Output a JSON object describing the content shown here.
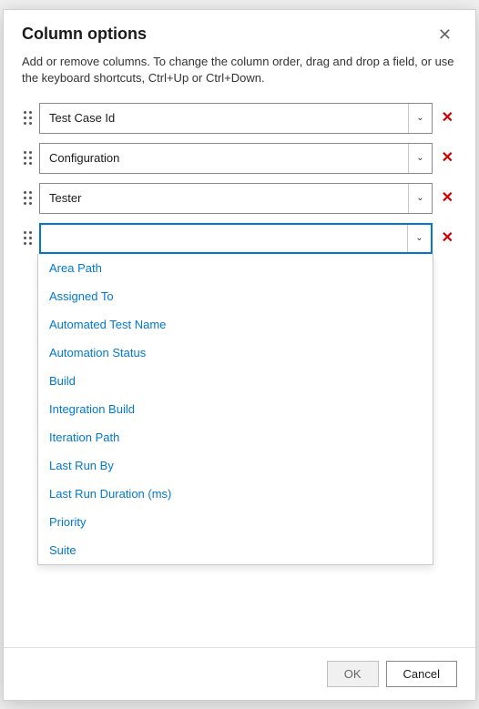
{
  "dialog": {
    "title": "Column options",
    "description": "Add or remove columns. To change the column order, drag and drop a field, or use the keyboard shortcuts, Ctrl+Up or Ctrl+Down.",
    "close_label": "✕"
  },
  "columns": [
    {
      "id": "test-case-id",
      "label": "Test Case Id"
    },
    {
      "id": "configuration",
      "label": "Configuration"
    },
    {
      "id": "tester",
      "label": "Tester"
    }
  ],
  "active_input": {
    "placeholder": "",
    "value": ""
  },
  "dropdown": {
    "items": [
      {
        "id": "area-path",
        "label": "Area Path"
      },
      {
        "id": "assigned-to",
        "label": "Assigned To"
      },
      {
        "id": "automated-test-name",
        "label": "Automated Test Name"
      },
      {
        "id": "automation-status",
        "label": "Automation Status"
      },
      {
        "id": "build",
        "label": "Build"
      },
      {
        "id": "integration-build",
        "label": "Integration Build"
      },
      {
        "id": "iteration-path",
        "label": "Iteration Path"
      },
      {
        "id": "last-run-by",
        "label": "Last Run By"
      },
      {
        "id": "last-run-duration",
        "label": "Last Run Duration (ms)"
      },
      {
        "id": "priority",
        "label": "Priority"
      },
      {
        "id": "suite",
        "label": "Suite"
      }
    ]
  },
  "footer": {
    "ok_label": "OK",
    "cancel_label": "Cancel"
  }
}
